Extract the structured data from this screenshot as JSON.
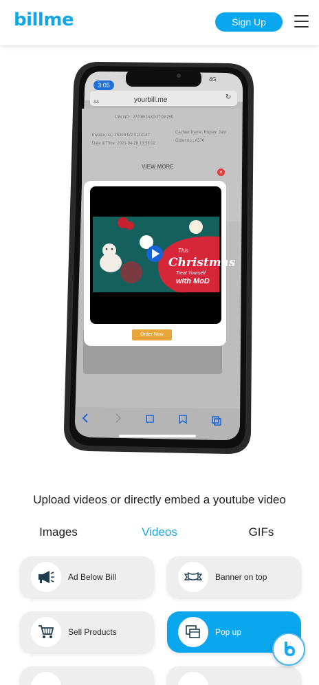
{
  "header": {
    "logo": "billme",
    "signup_label": "Sign Up"
  },
  "phone": {
    "time": "3:05",
    "status_right": "4G",
    "aa": "AA",
    "url": "yourbill.me",
    "reload": "↻",
    "cin": "CIN NO : 27238/JAX0/JTG8759",
    "invoice": "Invoice no.: 25329 0/2 0144147",
    "cashier": "Cashier Name: Rupam Jain",
    "datetime": "Date & Time: 2021-04-26  13:58:02",
    "order": "Order no.: A576",
    "view_more": "VIEW MORE",
    "close": "×",
    "video_line1": "This",
    "video_line2": "Christmas",
    "video_line3": "Treat Yourself",
    "video_line4": "with MoD",
    "order_now": "Order Now"
  },
  "caption": "Upload videos or directly embed a youtube video",
  "tabs": [
    {
      "label": "Images"
    },
    {
      "label": "Videos"
    },
    {
      "label": "GIFs"
    }
  ],
  "options": [
    {
      "label": "Ad Below Bill",
      "icon": "megaphone-icon"
    },
    {
      "label": "Banner on top",
      "icon": "banner-icon"
    },
    {
      "label": "Sell Products",
      "icon": "cart-icon"
    },
    {
      "label": "Pop up",
      "icon": "popup-icon"
    }
  ],
  "colors": {
    "accent": "#0aa6ee",
    "tab_active": "#1da7e8",
    "card": "#eeeeee"
  },
  "fab_icon": "billme-chat-icon"
}
